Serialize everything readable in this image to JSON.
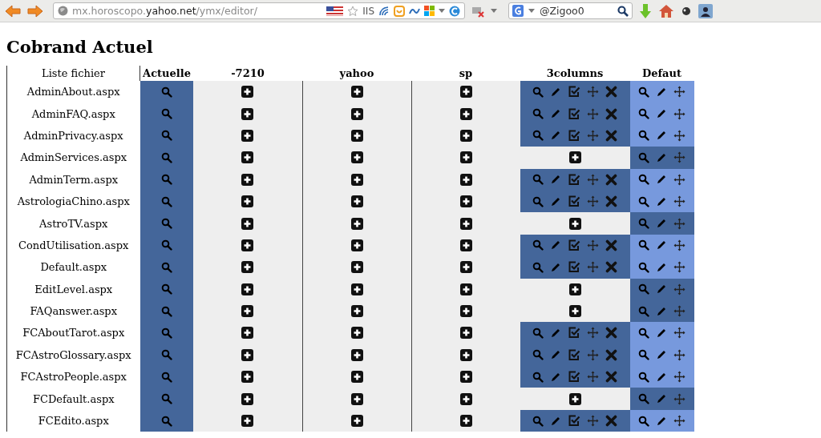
{
  "browser": {
    "url": "mx.horoscopo.**yahoo.net**/ymx/editor/",
    "url_badge": "IIS",
    "search": {
      "value": "@Zigoo0"
    }
  },
  "heading": "Cobrand Actuel",
  "table": {
    "columns": [
      "Liste fichier",
      "Actuelle",
      "-7210",
      "yahoo",
      "sp",
      "3columns",
      "Defaut"
    ],
    "rows": [
      {
        "file": "AdminAbout.aspx",
        "cells": [
          {
            "kind": "view"
          },
          {
            "kind": "add"
          },
          {
            "kind": "add"
          },
          {
            "kind": "add"
          },
          {
            "kind": "manage"
          },
          {
            "kind": "default",
            "highlighted": true
          }
        ]
      },
      {
        "file": "AdminFAQ.aspx",
        "cells": [
          {
            "kind": "view"
          },
          {
            "kind": "add"
          },
          {
            "kind": "add"
          },
          {
            "kind": "add"
          },
          {
            "kind": "manage"
          },
          {
            "kind": "default",
            "highlighted": true
          }
        ]
      },
      {
        "file": "AdminPrivacy.aspx",
        "cells": [
          {
            "kind": "view"
          },
          {
            "kind": "add"
          },
          {
            "kind": "add"
          },
          {
            "kind": "add"
          },
          {
            "kind": "manage"
          },
          {
            "kind": "default",
            "highlighted": true
          }
        ]
      },
      {
        "file": "AdminServices.aspx",
        "cells": [
          {
            "kind": "view"
          },
          {
            "kind": "add"
          },
          {
            "kind": "add"
          },
          {
            "kind": "add"
          },
          {
            "kind": "add"
          },
          {
            "kind": "default",
            "highlighted": false
          }
        ]
      },
      {
        "file": "AdminTerm.aspx",
        "cells": [
          {
            "kind": "view"
          },
          {
            "kind": "add"
          },
          {
            "kind": "add"
          },
          {
            "kind": "add"
          },
          {
            "kind": "manage"
          },
          {
            "kind": "default",
            "highlighted": true
          }
        ]
      },
      {
        "file": "AstrologiaChino.aspx",
        "cells": [
          {
            "kind": "view"
          },
          {
            "kind": "add"
          },
          {
            "kind": "add"
          },
          {
            "kind": "add"
          },
          {
            "kind": "manage"
          },
          {
            "kind": "default",
            "highlighted": true
          }
        ]
      },
      {
        "file": "AstroTV.aspx",
        "cells": [
          {
            "kind": "view"
          },
          {
            "kind": "add"
          },
          {
            "kind": "add"
          },
          {
            "kind": "add"
          },
          {
            "kind": "add"
          },
          {
            "kind": "default",
            "highlighted": false
          }
        ]
      },
      {
        "file": "CondUtilisation.aspx",
        "cells": [
          {
            "kind": "view"
          },
          {
            "kind": "add"
          },
          {
            "kind": "add"
          },
          {
            "kind": "add"
          },
          {
            "kind": "manage"
          },
          {
            "kind": "default",
            "highlighted": true
          }
        ]
      },
      {
        "file": "Default.aspx",
        "cells": [
          {
            "kind": "view"
          },
          {
            "kind": "add"
          },
          {
            "kind": "add"
          },
          {
            "kind": "add"
          },
          {
            "kind": "manage"
          },
          {
            "kind": "default",
            "highlighted": true
          }
        ]
      },
      {
        "file": "EditLevel.aspx",
        "cells": [
          {
            "kind": "view"
          },
          {
            "kind": "add"
          },
          {
            "kind": "add"
          },
          {
            "kind": "add"
          },
          {
            "kind": "add"
          },
          {
            "kind": "default",
            "highlighted": false
          }
        ]
      },
      {
        "file": "FAQanswer.aspx",
        "cells": [
          {
            "kind": "view"
          },
          {
            "kind": "add"
          },
          {
            "kind": "add"
          },
          {
            "kind": "add"
          },
          {
            "kind": "add"
          },
          {
            "kind": "default",
            "highlighted": false
          }
        ]
      },
      {
        "file": "FCAboutTarot.aspx",
        "cells": [
          {
            "kind": "view"
          },
          {
            "kind": "add"
          },
          {
            "kind": "add"
          },
          {
            "kind": "add"
          },
          {
            "kind": "manage"
          },
          {
            "kind": "default",
            "highlighted": true
          }
        ]
      },
      {
        "file": "FCAstroGlossary.aspx",
        "cells": [
          {
            "kind": "view"
          },
          {
            "kind": "add"
          },
          {
            "kind": "add"
          },
          {
            "kind": "add"
          },
          {
            "kind": "manage"
          },
          {
            "kind": "default",
            "highlighted": true
          }
        ]
      },
      {
        "file": "FCAstroPeople.aspx",
        "cells": [
          {
            "kind": "view"
          },
          {
            "kind": "add"
          },
          {
            "kind": "add"
          },
          {
            "kind": "add"
          },
          {
            "kind": "manage"
          },
          {
            "kind": "default",
            "highlighted": true
          }
        ]
      },
      {
        "file": "FCDefault.aspx",
        "cells": [
          {
            "kind": "view"
          },
          {
            "kind": "add"
          },
          {
            "kind": "add"
          },
          {
            "kind": "add"
          },
          {
            "kind": "add"
          },
          {
            "kind": "default",
            "highlighted": false
          }
        ]
      },
      {
        "file": "FCEdito.aspx",
        "cells": [
          {
            "kind": "view"
          },
          {
            "kind": "add"
          },
          {
            "kind": "add"
          },
          {
            "kind": "add"
          },
          {
            "kind": "manage"
          },
          {
            "kind": "default",
            "highlighted": true
          }
        ]
      }
    ]
  }
}
